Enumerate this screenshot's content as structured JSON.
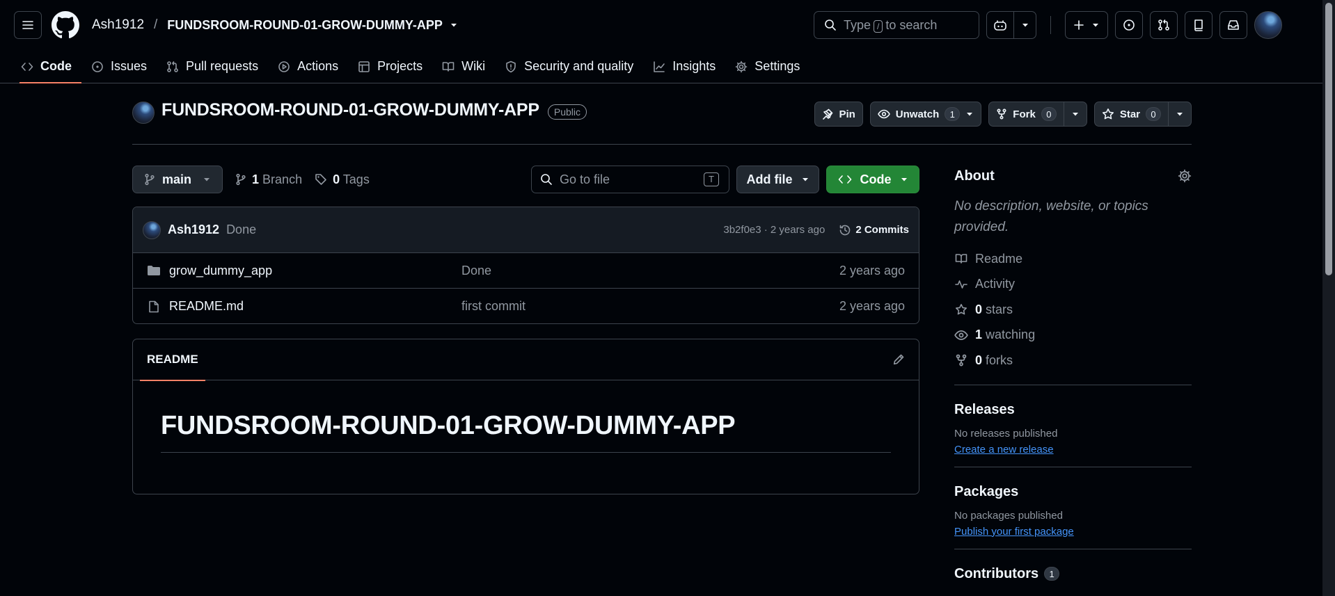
{
  "header": {
    "owner": "Ash1912",
    "separator": "/",
    "repo": "FUNDSROOM-ROUND-01-GROW-DUMMY-APP",
    "search": {
      "before": "Type",
      "key": "/",
      "after": "to search"
    }
  },
  "nav": [
    {
      "label": "Code",
      "icon": "code-icon"
    },
    {
      "label": "Issues",
      "icon": "issue-icon"
    },
    {
      "label": "Pull requests",
      "icon": "pull-request-icon"
    },
    {
      "label": "Actions",
      "icon": "play-icon"
    },
    {
      "label": "Projects",
      "icon": "table-icon"
    },
    {
      "label": "Wiki",
      "icon": "book-icon"
    },
    {
      "label": "Security and quality",
      "icon": "shield-icon"
    },
    {
      "label": "Insights",
      "icon": "graph-icon"
    },
    {
      "label": "Settings",
      "icon": "gear-icon"
    }
  ],
  "repo": {
    "name": "FUNDSROOM-ROUND-01-GROW-DUMMY-APP",
    "visibility": "Public",
    "pin": "Pin",
    "watch": {
      "label": "Unwatch",
      "count": "1"
    },
    "fork": {
      "label": "Fork",
      "count": "0"
    },
    "star": {
      "label": "Star",
      "count": "0"
    }
  },
  "toolbar": {
    "branch": "main",
    "branches_count": "1",
    "branches_label": "Branch",
    "tags_count": "0",
    "tags_label": "Tags",
    "goto_placeholder": "Go to file",
    "goto_key": "T",
    "add_file": "Add file",
    "code": "Code"
  },
  "latest_commit": {
    "author": "Ash1912",
    "message": "Done",
    "meta": "3b2f0e3 · 2 years ago",
    "commits": "2 Commits"
  },
  "files": [
    {
      "name": "grow_dummy_app",
      "type": "folder",
      "message": "Done",
      "age": "2 years ago"
    },
    {
      "name": "README.md",
      "type": "file",
      "message": "first commit",
      "age": "2 years ago"
    }
  ],
  "readme": {
    "tab": "README",
    "heading": "FUNDSROOM-ROUND-01-GROW-DUMMY-APP"
  },
  "about": {
    "title": "About",
    "description": "No description, website, or topics provided.",
    "items": [
      {
        "icon": "book-icon",
        "strong": "",
        "label": "Readme"
      },
      {
        "icon": "pulse-icon",
        "strong": "",
        "label": "Activity"
      },
      {
        "icon": "star-icon",
        "strong": "0",
        "label": "stars"
      },
      {
        "icon": "eye-icon",
        "strong": "1",
        "label": "watching"
      },
      {
        "icon": "fork-icon",
        "strong": "0",
        "label": "forks"
      }
    ]
  },
  "releases": {
    "title": "Releases",
    "text": "No releases published",
    "link": "Create a new release"
  },
  "packages": {
    "title": "Packages",
    "text": "No packages published",
    "link": "Publish your first package"
  },
  "contributors": {
    "title": "Contributors",
    "count": "1"
  }
}
